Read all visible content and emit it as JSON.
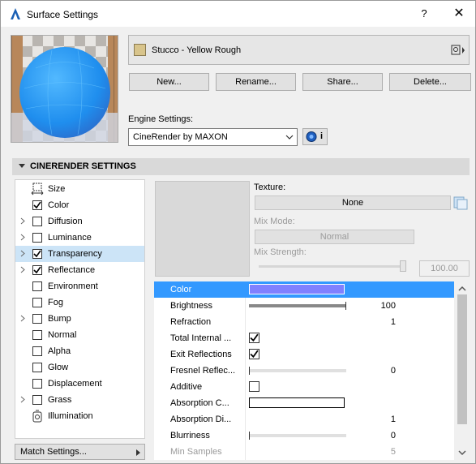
{
  "window": {
    "title": "Surface Settings",
    "help": "?",
    "close": "✕"
  },
  "material": {
    "name": "Stucco - Yellow Rough",
    "swatch_color": "#d8c48b"
  },
  "buttons": {
    "new": "New...",
    "rename": "Rename...",
    "share": "Share...",
    "delete": "Delete..."
  },
  "engine": {
    "label": "Engine Settings:",
    "value": "CineRender by MAXON",
    "info": "i"
  },
  "section": {
    "title": "CINERENDER SETTINGS"
  },
  "categories": [
    {
      "label": "Size",
      "expandable": false,
      "checked": null
    },
    {
      "label": "Color",
      "expandable": false,
      "checked": true
    },
    {
      "label": "Diffusion",
      "expandable": true,
      "checked": false
    },
    {
      "label": "Luminance",
      "expandable": true,
      "checked": false
    },
    {
      "label": "Transparency",
      "expandable": true,
      "checked": true,
      "selected": true
    },
    {
      "label": "Reflectance",
      "expandable": true,
      "checked": true
    },
    {
      "label": "Environment",
      "expandable": false,
      "checked": false
    },
    {
      "label": "Fog",
      "expandable": false,
      "checked": false
    },
    {
      "label": "Bump",
      "expandable": true,
      "checked": false
    },
    {
      "label": "Normal",
      "expandable": false,
      "checked": false
    },
    {
      "label": "Alpha",
      "expandable": false,
      "checked": false
    },
    {
      "label": "Glow",
      "expandable": false,
      "checked": false
    },
    {
      "label": "Displacement",
      "expandable": false,
      "checked": false
    },
    {
      "label": "Grass",
      "expandable": true,
      "checked": false
    },
    {
      "label": "Illumination",
      "expandable": false,
      "checked": null
    }
  ],
  "match_settings": "Match Settings...",
  "texture": {
    "label": "Texture:",
    "value": "None",
    "mix_mode_label": "Mix Mode:",
    "mix_mode_value": "Normal",
    "mix_strength_label": "Mix Strength:",
    "mix_strength_value": "100.00"
  },
  "params": [
    {
      "name": "Color",
      "kind": "color",
      "color": "#8080ff",
      "selected": true
    },
    {
      "name": "Brightness",
      "kind": "slider",
      "fraction": 1.0,
      "value": "100"
    },
    {
      "name": "Refraction",
      "kind": "value",
      "value": "1"
    },
    {
      "name": "Total Internal ...",
      "kind": "check",
      "checked": true
    },
    {
      "name": "Exit Reflections",
      "kind": "check",
      "checked": true
    },
    {
      "name": "Fresnel Reflec...",
      "kind": "slider",
      "fraction": 0.0,
      "value": "0"
    },
    {
      "name": "Additive",
      "kind": "check",
      "checked": false
    },
    {
      "name": "Absorption C...",
      "kind": "color",
      "color": "#ffffff"
    },
    {
      "name": "Absorption Di...",
      "kind": "value",
      "value": "1"
    },
    {
      "name": "Blurriness",
      "kind": "slider",
      "fraction": 0.0,
      "value": "0"
    },
    {
      "name": "Min Samples",
      "kind": "value",
      "value": "5",
      "disabled": true
    }
  ]
}
